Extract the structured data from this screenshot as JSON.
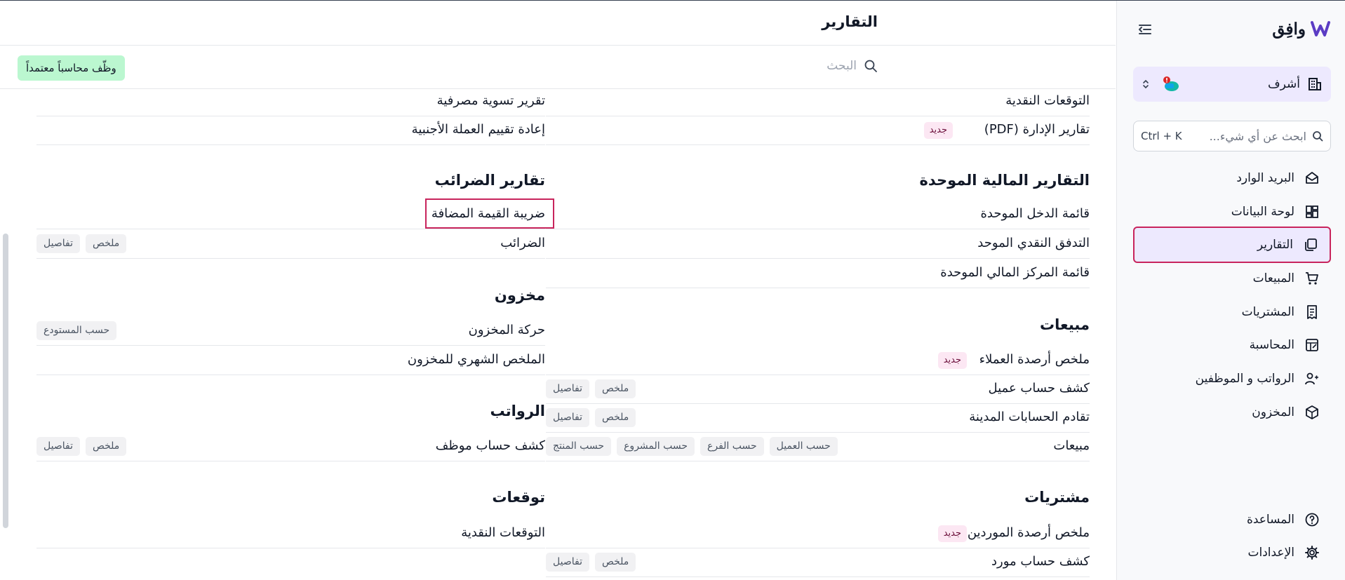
{
  "app": {
    "brand": "وافِق",
    "page_title": "التقارير"
  },
  "colors": {
    "accent": "#c8245c",
    "active_bg": "#ede9fe",
    "cta_bg": "#bbf7d0",
    "new_badge_bg": "#fce7f3"
  },
  "sidebar": {
    "org_name": "أشرف",
    "search_placeholder": "ابحث عن أي شيء...",
    "search_shortcut": "Ctrl + K",
    "nav": [
      {
        "label": "البريد الوارد",
        "icon": "inbox-icon"
      },
      {
        "label": "لوحة البيانات",
        "icon": "dashboard-icon"
      },
      {
        "label": "التقارير",
        "icon": "reports-icon",
        "active": true
      },
      {
        "label": "المبيعات",
        "icon": "cart-icon"
      },
      {
        "label": "المشتريات",
        "icon": "receipt-icon"
      },
      {
        "label": "المحاسبة",
        "icon": "ledger-icon"
      },
      {
        "label": "الرواتب و الموظفين",
        "icon": "users-icon"
      },
      {
        "label": "المخزون",
        "icon": "box-icon"
      }
    ],
    "footer": [
      {
        "label": "المساعدة",
        "icon": "help-icon"
      },
      {
        "label": "الإعدادات",
        "icon": "gear-icon"
      }
    ]
  },
  "main": {
    "search_label": "البحث",
    "cta": "وظّف محاسباً معتمداً",
    "badges": {
      "new": "جديد",
      "summary": "ملخص",
      "details": "تفاصيل"
    },
    "right_column": {
      "top_rows": [
        "التوقعات النقدية",
        "تقارير الإدارة (PDF)"
      ],
      "consolidated": {
        "heading": "التقارير المالية الموحدة",
        "rows": [
          "قائمة الدخل الموحدة",
          "التدفق النقدي الموحد",
          "قائمة المركز المالي الموحدة"
        ]
      },
      "sales": {
        "heading": "مبيعات",
        "rows": [
          "ملخص أرصدة العملاء",
          "كشف حساب عميل",
          "تقادم الحسابات المدينة",
          "مبيعات"
        ],
        "sales_tags": [
          "حسب العميل",
          "حسب الفرع",
          "حسب المشروع",
          "حسب المنتج"
        ]
      },
      "purchases": {
        "heading": "مشتريات",
        "rows": [
          "ملخص أرصدة الموردين",
          "كشف حساب مورد"
        ]
      }
    },
    "left_column": {
      "top_rows": [
        "تقرير تسوية مصرفية",
        "إعادة تقييم العملة الأجنبية"
      ],
      "tax": {
        "heading": "تقارير الضرائب",
        "rows": [
          "ضريبة القيمة المضافة",
          "الضرائب"
        ]
      },
      "inventory": {
        "heading": "مخزون",
        "rows": [
          "حركة المخزون",
          "الملخص الشهري للمخزون"
        ],
        "by_warehouse": "حسب المستودع"
      },
      "payroll": {
        "heading": "الرواتب",
        "rows": [
          "كشف حساب موظف"
        ]
      },
      "forecasts": {
        "heading": "توقعات",
        "rows": [
          "التوقعات النقدية"
        ]
      }
    }
  }
}
